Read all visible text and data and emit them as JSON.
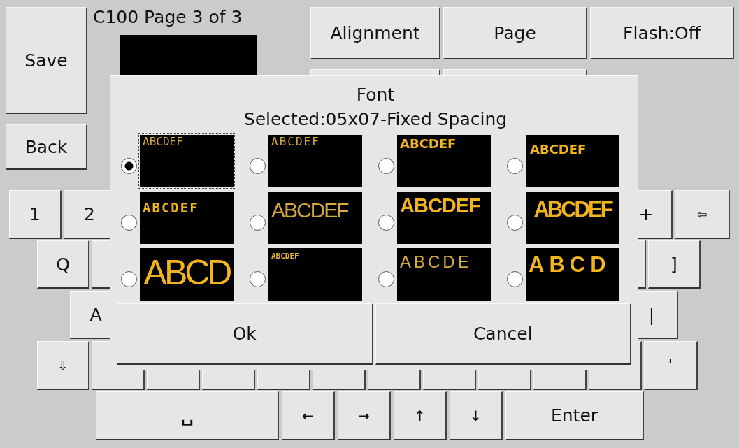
{
  "header": {
    "title": "C100 Page 3 of 3"
  },
  "side_buttons": [
    "Save",
    "Back"
  ],
  "top_buttons": [
    "Alignment",
    "Page",
    "Flash:Off"
  ],
  "keyboard": {
    "number_row": [
      "1",
      "2",
      "+",
      "⇦"
    ],
    "upper_row": [
      "Q",
      "]"
    ],
    "middle_row": [
      "A",
      "|"
    ],
    "lower_row": [
      "⇩",
      "'"
    ],
    "bottom_row": [
      "␣",
      "←",
      "→",
      "↑",
      "↓",
      "Enter"
    ]
  },
  "dialog": {
    "title": "Font",
    "selected_label": "Selected:05x07-Fixed Spacing",
    "fonts": [
      {
        "sample": "ABCDEF",
        "kind": "thin",
        "selected": true
      },
      {
        "sample": "ABCDEF",
        "kind": "thin-spaced",
        "selected": false
      },
      {
        "sample": "ABCDEF",
        "kind": "bold",
        "selected": false
      },
      {
        "sample": "ABCDEF",
        "kind": "bold-low",
        "selected": false
      },
      {
        "sample": "ABCDEF",
        "kind": "bold-spaced",
        "selected": false
      },
      {
        "sample": "ABCDEF",
        "kind": "narrow",
        "selected": false
      },
      {
        "sample": "ABCDEF",
        "kind": "bold-tall",
        "selected": false
      },
      {
        "sample": "ABCDEF",
        "kind": "condensed-tall",
        "selected": false
      },
      {
        "sample": "ABCD",
        "kind": "huge",
        "selected": false
      },
      {
        "sample": "ABCDEF",
        "kind": "tiny",
        "selected": false
      },
      {
        "sample": "ABCDE",
        "kind": "spaced",
        "selected": false
      },
      {
        "sample": "ABCD",
        "kind": "wide-bold",
        "selected": false
      }
    ],
    "buttons": [
      "Ok",
      "Cancel"
    ]
  }
}
